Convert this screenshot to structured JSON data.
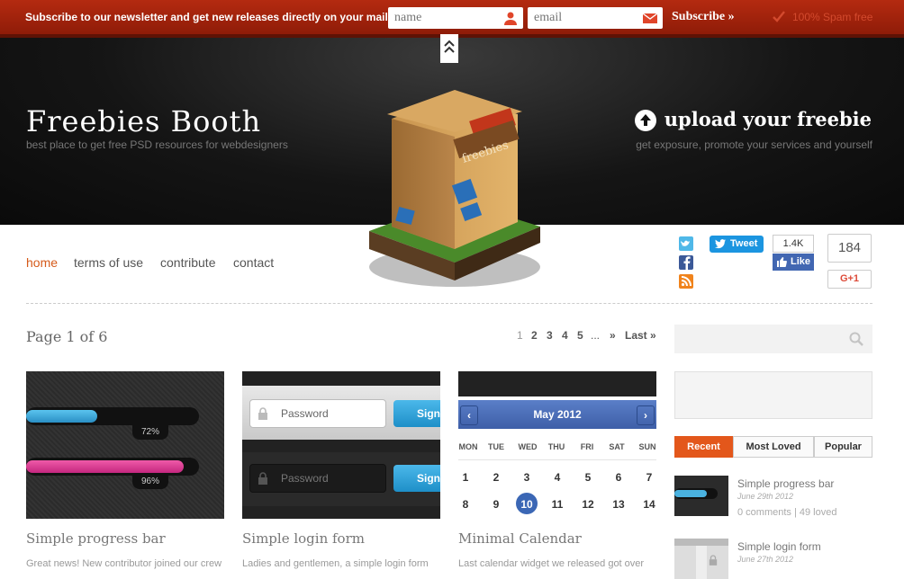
{
  "newsletter": {
    "message": "Subscribe to our newsletter and get new releases directly on your mailbox!",
    "name_placeholder": "name",
    "email_placeholder": "email",
    "subscribe_label": "Subscribe »",
    "spam_label": "100% Spam free"
  },
  "hero": {
    "title": "Freebies Booth",
    "tagline": "best place to get free PSD resources for webdesigners",
    "upload_title": "upload your freebie",
    "upload_sub": "get exposure, promote your services and yourself",
    "booth_sign": "freebies"
  },
  "nav": {
    "items": [
      "home",
      "terms of use",
      "contribute",
      "contact"
    ]
  },
  "social": {
    "tweet": "Tweet",
    "fb_count": "1.4K",
    "fb_like": "Like",
    "gplus_count": "184",
    "gplus_label": "G+1"
  },
  "main": {
    "page_title": "Page 1 of 6",
    "pager": [
      "1",
      "2",
      "3",
      "4",
      "5",
      "...",
      "»",
      "Last »"
    ]
  },
  "cards": [
    {
      "title": "Simple progress bar",
      "excerpt": "Great news! New contributor joined our crew"
    },
    {
      "title": "Simple login form",
      "excerpt": "Ladies and gentlemen, a simple login form"
    },
    {
      "title": "Minimal Calendar",
      "excerpt": "Last calendar widget we released got over"
    }
  ],
  "progress_demo": {
    "bar1_percent": 72,
    "bar1_label": "72%",
    "bar2_percent": 96,
    "bar2_label": "96%"
  },
  "login_demo": {
    "password_label": "Password",
    "sign_label": "Sign"
  },
  "calendar_demo": {
    "month": "May 2012",
    "prev": "‹",
    "next": "›",
    "weekdays": [
      "MON",
      "TUE",
      "WED",
      "THU",
      "FRI",
      "SAT",
      "SUN"
    ],
    "week1": [
      "1",
      "2",
      "3",
      "4",
      "5",
      "6",
      "7"
    ],
    "week2": [
      "8",
      "9",
      "10",
      "11",
      "12",
      "13",
      "14"
    ],
    "today": "10"
  },
  "sidebar": {
    "tabs": [
      "Recent",
      "Most Loved",
      "Popular"
    ],
    "posts": [
      {
        "title": "Simple progress bar",
        "date": "June 29th 2012",
        "meta": "0 comments | 49 loved"
      },
      {
        "title": "Simple login form",
        "date": "June 27th 2012"
      }
    ]
  },
  "colors": {
    "accent": "#e3571b",
    "topbar": "#a4240c",
    "twitter": "#1b95e0",
    "facebook": "#4267b2"
  }
}
